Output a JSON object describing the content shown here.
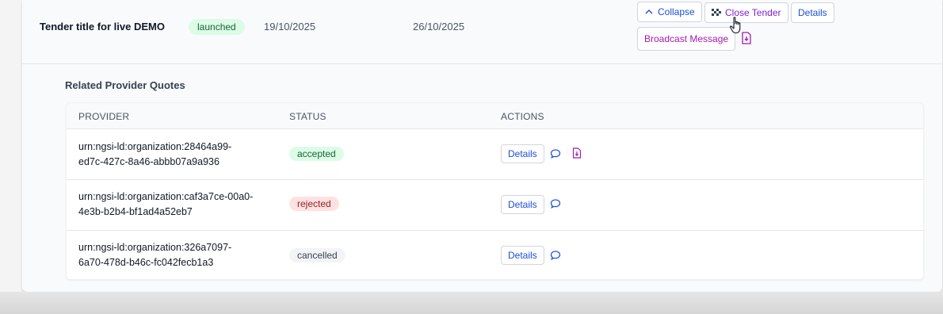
{
  "tender": {
    "title": "Tender title for live DEMO",
    "status": "launched",
    "start_date": "19/10/2025",
    "end_date": "26/10/2025",
    "buttons": {
      "collapse": "Collapse",
      "close_tender": "Close Tender",
      "details": "Details",
      "broadcast": "Broadcast Message"
    }
  },
  "quotes": {
    "section_title": "Related Provider Quotes",
    "headers": {
      "provider": "PROVIDER",
      "status": "STATUS",
      "actions": "ACTIONS"
    },
    "rows": [
      {
        "provider_line1": "urn:ngsi-ld:organization:28464a99-",
        "provider_line2": "ed7c-427c-8a46-abbb07a9a936",
        "status": "accepted",
        "details": "Details"
      },
      {
        "provider_line1": "urn:ngsi-ld:organization:caf3a7ce-00a0-",
        "provider_line2": "4e3b-b2b4-bf1ad4a52eb7",
        "status": "rejected",
        "details": "Details"
      },
      {
        "provider_line1": "urn:ngsi-ld:organization:326a7097-",
        "provider_line2": "6a70-478d-b46c-fc042fecb1a3",
        "status": "cancelled",
        "details": "Details"
      }
    ]
  },
  "colors": {
    "accent_blue": "#1d4ed8",
    "close_purple": "#7e22ce",
    "broadcast_magenta": "#a21caf",
    "accepted_bg": "#dcfce7",
    "rejected_bg": "#fee2e2",
    "cancelled_bg": "#f3f4f6"
  },
  "icons": {
    "collapse": "chevron-up-icon",
    "close_tender": "checkered-flag-icon",
    "document": "document-download-icon",
    "message": "chat-bubble-icon",
    "cursor": "hand-pointer-icon"
  }
}
